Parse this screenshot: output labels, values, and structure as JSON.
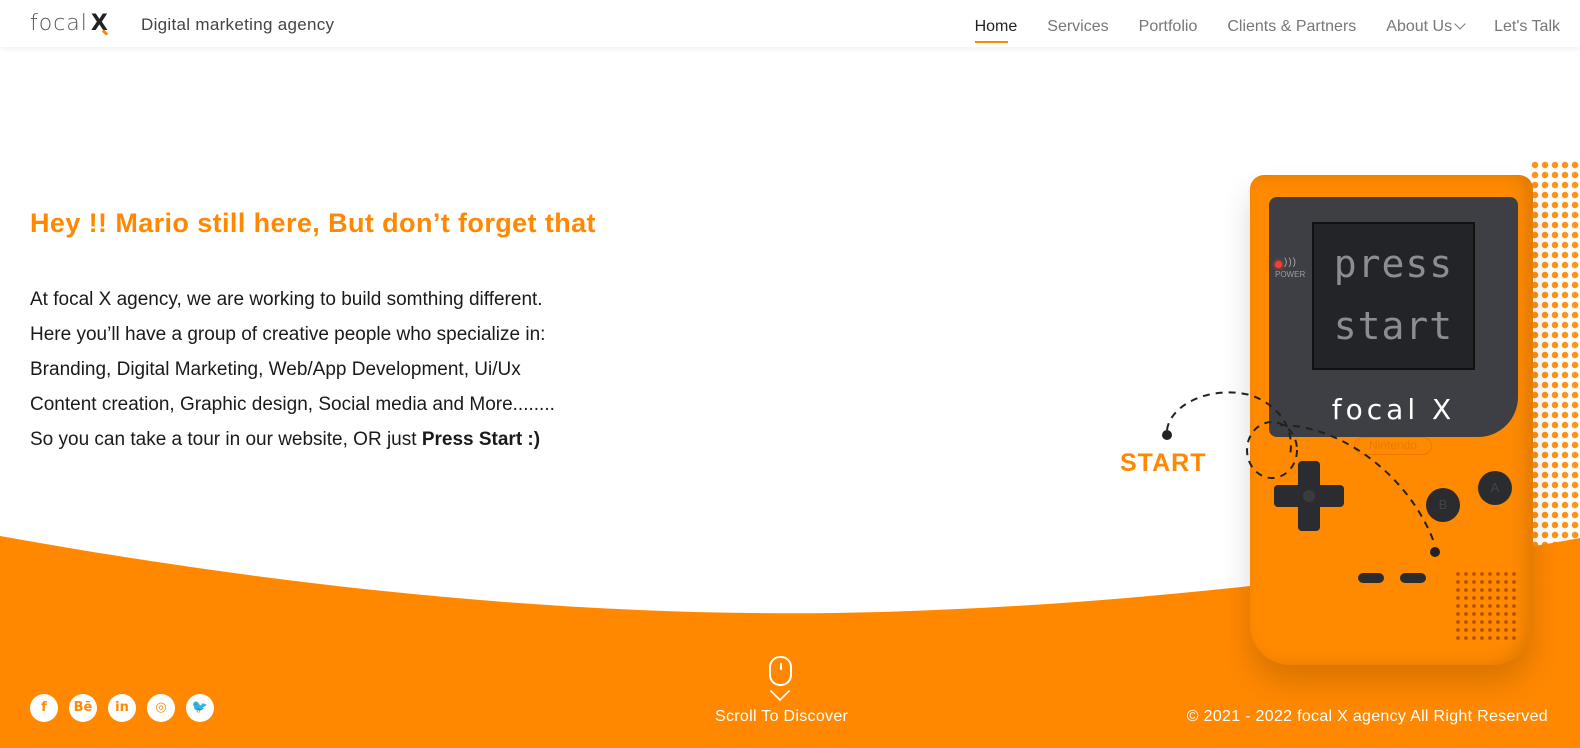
{
  "header": {
    "logo_text": "focal",
    "logo_mark": "X",
    "tagline": "Digital marketing agency",
    "nav": [
      {
        "label": "Home",
        "active": true
      },
      {
        "label": "Services"
      },
      {
        "label": "Portfolio"
      },
      {
        "label": "Clients & Partners"
      },
      {
        "label": "About Us",
        "has_dropdown": true
      },
      {
        "label": "Let's Talk"
      }
    ]
  },
  "hero": {
    "title": "Hey !! Mario still here, But don’t forget that",
    "lines": [
      "At focal X agency, we are working to build somthing different.",
      "Here you’ll have a group of creative people who specialize in:",
      "Branding, Digital Marketing, Web/App Development, Ui/Ux",
      "Content creation, Graphic design, Social media and More........"
    ],
    "last_line_prefix": "So you can take a tour in our website, OR just ",
    "last_line_bold": "Press Start :)"
  },
  "gameboy": {
    "screen_line1": "press",
    "screen_line2": "start",
    "power_label": "POWER",
    "brand": "focal X",
    "nintendo": "Nintendo",
    "btn_b": "B",
    "btn_a": "A",
    "start_label": "START"
  },
  "footer": {
    "socials": [
      {
        "name": "facebook-icon",
        "glyph": "f"
      },
      {
        "name": "behance-icon",
        "glyph": "Bē"
      },
      {
        "name": "linkedin-icon",
        "glyph": "in"
      },
      {
        "name": "instagram-icon",
        "glyph": "◎"
      },
      {
        "name": "twitter-icon",
        "glyph": "🐦"
      }
    ],
    "scroll_text": "Scroll To Discover",
    "copyright": "© 2021 - 2022 focal X agency All Right Reserved"
  },
  "colors": {
    "accent": "#ff8800",
    "device_dark": "#2b2c2f"
  }
}
